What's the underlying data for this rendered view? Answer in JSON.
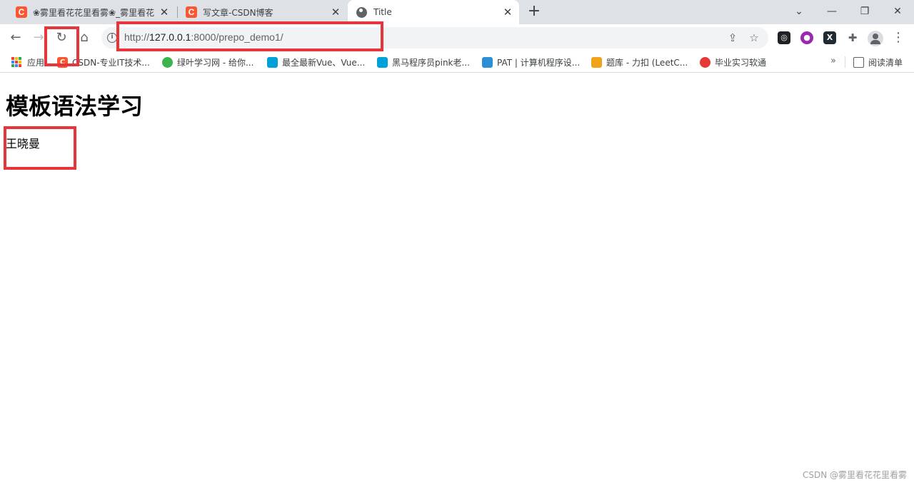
{
  "tabs": [
    {
      "title": "❀雾里看花花里看雾❀_雾里看花花里看雾",
      "icon": "csdn-icon",
      "icon_text": "C"
    },
    {
      "title": "写文章-CSDN博客",
      "icon": "csdn-icon",
      "icon_text": "C"
    },
    {
      "title": "Title",
      "icon": "globe-icon",
      "active": true
    }
  ],
  "toolbar": {
    "url_scheme": "http://",
    "url_host": "127.0.0.1",
    "url_rest": ":8000/prepo_demo1/",
    "info_glyph": "i"
  },
  "bookmarks": [
    {
      "label": "应用",
      "icon": "apps-grid-icon"
    },
    {
      "label": "CSDN-专业IT技术...",
      "icon": "csdn-icon",
      "icon_text": "C",
      "color": "#fc5531"
    },
    {
      "label": "绿叶学习网 - 给你...",
      "icon": "leaf-icon",
      "color": "#3cb44b"
    },
    {
      "label": "最全最新Vue、Vue...",
      "icon": "bilibili-icon",
      "color": "#00a1d6"
    },
    {
      "label": "黑马程序员pink老...",
      "icon": "bilibili-icon",
      "color": "#00a1d6"
    },
    {
      "label": "PAT | 计算机程序设...",
      "icon": "pat-icon",
      "color": "#2b8fd6"
    },
    {
      "label": "题库 - 力扣 (LeetC...",
      "icon": "leetcode-icon",
      "color": "#f0a21a"
    },
    {
      "label": "毕业实习软通",
      "icon": "softstone-icon",
      "color": "#e53935"
    }
  ],
  "reading_list": {
    "label": "阅读清单",
    "icon": "reading-list-icon"
  },
  "page": {
    "heading": "模板语法学习",
    "name": "王晓曼"
  },
  "watermark": "CSDN @雾里看花花里看雾",
  "colors": {
    "annotation": "#e8353a",
    "tabstrip": "#dee1e6",
    "omnibox": "#f1f3f4"
  }
}
